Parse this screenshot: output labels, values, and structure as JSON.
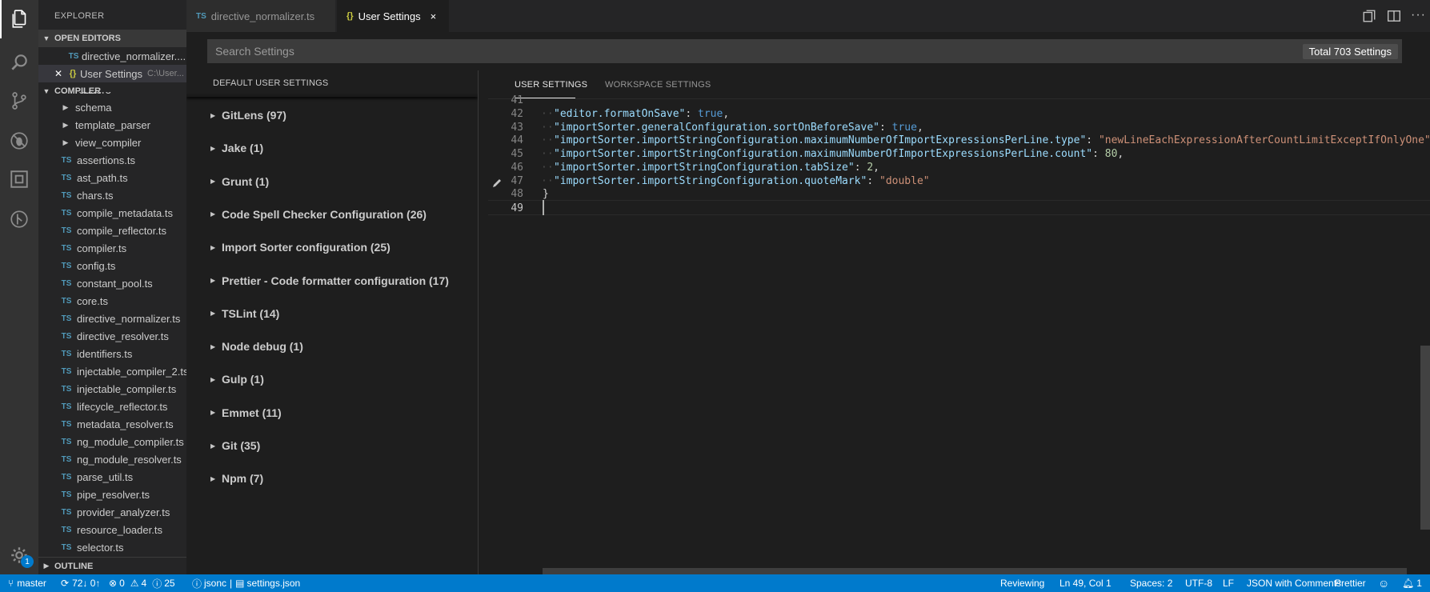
{
  "sidebar": {
    "title": "EXPLORER",
    "open_editors_label": "OPEN EDITORS",
    "open_editors": [
      {
        "badge": "TS",
        "name": "directive_normalizer....",
        "path": ""
      },
      {
        "badge": "{}",
        "name": "User Settings",
        "path": "C:\\User..."
      }
    ],
    "folder_label": "COMPILER",
    "tree": [
      {
        "name": "render3",
        "type": "folder"
      },
      {
        "name": "schema",
        "type": "folder"
      },
      {
        "name": "template_parser",
        "type": "folder"
      },
      {
        "name": "view_compiler",
        "type": "folder"
      },
      {
        "name": "assertions.ts",
        "type": "ts"
      },
      {
        "name": "ast_path.ts",
        "type": "ts"
      },
      {
        "name": "chars.ts",
        "type": "ts"
      },
      {
        "name": "compile_metadata.ts",
        "type": "ts"
      },
      {
        "name": "compile_reflector.ts",
        "type": "ts"
      },
      {
        "name": "compiler.ts",
        "type": "ts"
      },
      {
        "name": "config.ts",
        "type": "ts"
      },
      {
        "name": "constant_pool.ts",
        "type": "ts"
      },
      {
        "name": "core.ts",
        "type": "ts"
      },
      {
        "name": "directive_normalizer.ts",
        "type": "ts"
      },
      {
        "name": "directive_resolver.ts",
        "type": "ts"
      },
      {
        "name": "identifiers.ts",
        "type": "ts"
      },
      {
        "name": "injectable_compiler_2.ts",
        "type": "ts"
      },
      {
        "name": "injectable_compiler.ts",
        "type": "ts"
      },
      {
        "name": "lifecycle_reflector.ts",
        "type": "ts"
      },
      {
        "name": "metadata_resolver.ts",
        "type": "ts"
      },
      {
        "name": "ng_module_compiler.ts",
        "type": "ts"
      },
      {
        "name": "ng_module_resolver.ts",
        "type": "ts"
      },
      {
        "name": "parse_util.ts",
        "type": "ts"
      },
      {
        "name": "pipe_resolver.ts",
        "type": "ts"
      },
      {
        "name": "provider_analyzer.ts",
        "type": "ts"
      },
      {
        "name": "resource_loader.ts",
        "type": "ts"
      },
      {
        "name": "selector.ts",
        "type": "ts"
      }
    ],
    "ts_badge": "TS",
    "outline_label": "OUTLINE"
  },
  "activity": {
    "icons": [
      "files-icon",
      "search-icon",
      "source-control-icon",
      "debug-icon",
      "extensions-icon",
      "git-history-icon"
    ],
    "settings_badge": "1"
  },
  "tabs": [
    {
      "badge": "TS",
      "label": "directive_normalizer.ts",
      "active": false
    },
    {
      "badge": "{}",
      "label": "User Settings",
      "active": true,
      "close": "×"
    }
  ],
  "settings": {
    "search_placeholder": "Search Settings",
    "total": "Total 703 Settings",
    "default_header": "DEFAULT USER SETTINGS",
    "categories": [
      "GitLens (97)",
      "Jake (1)",
      "Grunt (1)",
      "Code Spell Checker Configuration (26)",
      "Import Sorter configuration (25)",
      "Prettier - Code formatter configuration (17)",
      "TSLint (14)",
      "Node debug (1)",
      "Gulp (1)",
      "Emmet (11)",
      "Git (35)",
      "Npm (7)"
    ],
    "user_tab": "USER SETTINGS",
    "workspace_tab": "WORKSPACE SETTINGS"
  },
  "code": {
    "lines": [
      {
        "n": "41",
        "key": "",
        "value": "",
        "vtype": "",
        "comma": ""
      },
      {
        "n": "42",
        "key": "\"editor.formatOnSave\"",
        "value": "true",
        "vtype": "kw",
        "comma": ","
      },
      {
        "n": "43",
        "key": "\"importSorter.generalConfiguration.sortOnBeforeSave\"",
        "value": "true",
        "vtype": "kw",
        "comma": ","
      },
      {
        "n": "44",
        "key": "\"importSorter.importStringConfiguration.maximumNumberOfImportExpressionsPerLine.type\"",
        "value": "\"newLineEachExpressionAfterCountLimitExceptIfOnlyOne\"",
        "vtype": "s",
        "comma": ","
      },
      {
        "n": "45",
        "key": "\"importSorter.importStringConfiguration.maximumNumberOfImportExpressionsPerLine.count\"",
        "value": "80",
        "vtype": "n",
        "comma": ","
      },
      {
        "n": "46",
        "key": "\"importSorter.importStringConfiguration.tabSize\"",
        "value": "2",
        "vtype": "n",
        "comma": ","
      },
      {
        "n": "47",
        "key": "\"importSorter.importStringConfiguration.quoteMark\"",
        "value": "\"double\"",
        "vtype": "s",
        "comma": ""
      },
      {
        "n": "48",
        "key": "",
        "value": "",
        "vtype": "",
        "comma": "",
        "text": "}"
      },
      {
        "n": "49",
        "key": "",
        "value": "",
        "vtype": "",
        "comma": "",
        "text": ""
      }
    ]
  },
  "status": {
    "branch": "master",
    "sync": "72↓ 0↑",
    "errors": "0",
    "warnings": "4",
    "infos": "25",
    "language_mode": "jsonc",
    "file": "settings.json",
    "reviewing": "Reviewing",
    "position": "Ln 49, Col 1",
    "spaces": "Spaces: 2",
    "encoding": "UTF-8",
    "eol": "LF",
    "language": "JSON with Comments",
    "formatter": "Prettier",
    "notifications": "1"
  },
  "colors": {
    "status_bar": "#007acc",
    "activity_bar": "#333333",
    "sidebar": "#252526",
    "editor": "#1e1e1e"
  }
}
